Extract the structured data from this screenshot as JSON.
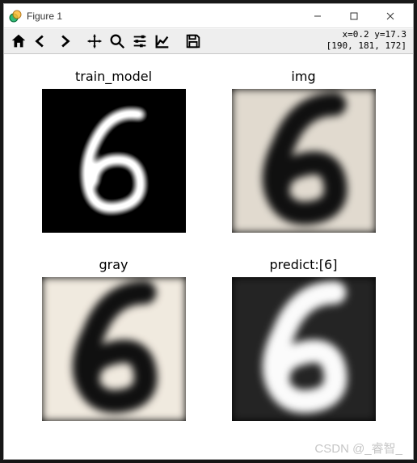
{
  "window": {
    "title": "Figure 1"
  },
  "toolbar": {
    "coords_line1": "x=0.2 y=17.3",
    "coords_line2": "[190, 181, 172]"
  },
  "subplots": [
    {
      "title": "train_model"
    },
    {
      "title": "img"
    },
    {
      "title": "gray"
    },
    {
      "title": "predict:[6]"
    }
  ],
  "watermark": "CSDN @_睿智_",
  "chart_data": {
    "type": "image_grid",
    "layout": {
      "rows": 2,
      "cols": 2
    },
    "cursor": {
      "x": 0.2,
      "y": 17.3,
      "rgb": [
        190,
        181,
        172
      ]
    },
    "images": [
      {
        "title": "train_model",
        "description": "28x28 MNIST digit 6, white stroke on black"
      },
      {
        "title": "img",
        "description": "photographed handdrawn 6, black ink on light paper, pixelated"
      },
      {
        "title": "gray",
        "description": "grayscale converted version of img, black 6 on light gray"
      },
      {
        "title": "predict:[6]",
        "description": "inverted grayscale, white 6 on dark gray, prediction label 6"
      }
    ],
    "prediction": 6
  }
}
